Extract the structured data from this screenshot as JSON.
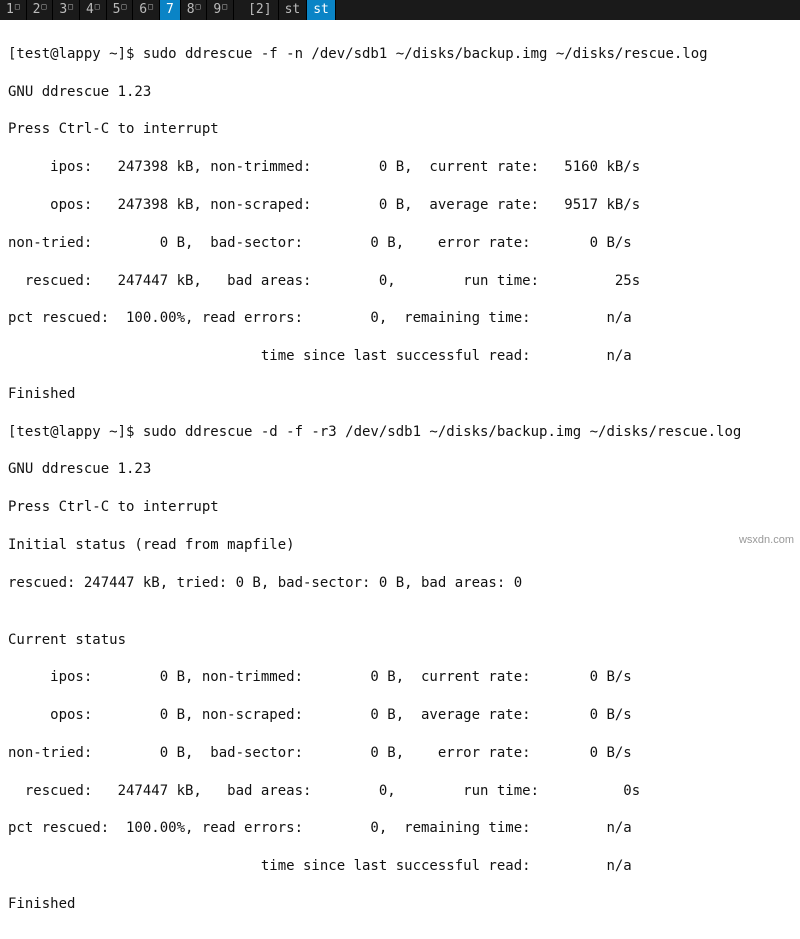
{
  "tabs": {
    "items": [
      {
        "num": "1",
        "sup": "□"
      },
      {
        "num": "2",
        "sup": "□"
      },
      {
        "num": "3",
        "sup": "□"
      },
      {
        "num": "4",
        "sup": "□"
      },
      {
        "num": "5",
        "sup": "□"
      },
      {
        "num": "6",
        "sup": "□"
      },
      {
        "num": "7",
        "sup": ""
      },
      {
        "num": "8",
        "sup": "□"
      },
      {
        "num": "9",
        "sup": "□"
      }
    ],
    "count": "[2]",
    "label1": "st",
    "label2": "st"
  },
  "prompt1": {
    "pre": "[test@lappy ~]$ ",
    "cmd": "sudo ddrescue -f -n /dev/sdb1 ~/disks/backup.img ~/disks/rescue.log"
  },
  "block1": {
    "l1": "GNU ddrescue 1.23",
    "l2": "Press Ctrl-C to interrupt",
    "l3": "     ipos:   247398 kB, non-trimmed:        0 B,  current rate:   5160 kB/s",
    "l4": "     opos:   247398 kB, non-scraped:        0 B,  average rate:   9517 kB/s",
    "l5": "non-tried:        0 B,  bad-sector:        0 B,    error rate:       0 B/s",
    "l6": "  rescued:   247447 kB,   bad areas:        0,        run time:         25s",
    "l7": "pct rescued:  100.00%, read errors:        0,  remaining time:         n/a",
    "l8": "                              time since last successful read:         n/a",
    "l9": "Finished"
  },
  "prompt2": {
    "pre": "[test@lappy ~]$ ",
    "cmd": "sudo ddrescue -d -f -r3 /dev/sdb1 ~/disks/backup.img ~/disks/rescue.log"
  },
  "block2": {
    "l1": "GNU ddrescue 1.23",
    "l2": "Press Ctrl-C to interrupt",
    "l3": "Initial status (read from mapfile)",
    "l4": "rescued: 247447 kB, tried: 0 B, bad-sector: 0 B, bad areas: 0",
    "l5": "",
    "l6": "Current status",
    "l7": "     ipos:        0 B, non-trimmed:        0 B,  current rate:       0 B/s",
    "l8": "     opos:        0 B, non-scraped:        0 B,  average rate:       0 B/s",
    "l9": "non-tried:        0 B,  bad-sector:        0 B,    error rate:       0 B/s",
    "l10": "  rescued:   247447 kB,   bad areas:        0,        run time:          0s",
    "l11": "pct rescued:  100.00%, read errors:        0,  remaining time:         n/a",
    "l12": "                              time since last successful read:         n/a",
    "l13": "Finished"
  },
  "watermark": "wsxdn.com"
}
